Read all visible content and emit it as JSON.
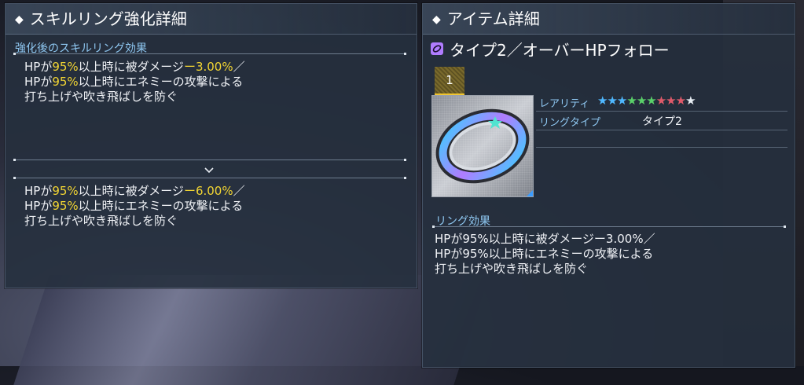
{
  "left_panel": {
    "title": "スキルリング強化詳細",
    "section_heading": "強化後のスキルリング効果",
    "current_effect": {
      "line1_a": "HPが",
      "line1_b": "95%",
      "line1_c": "以上時に被ダメージ",
      "line1_d": "ー3.00%",
      "line1_e": "／",
      "line2_a": "HPが",
      "line2_b": "95%",
      "line2_c": "以上時にエネミーの攻撃による",
      "line3": "打ち上げや吹き飛ばしを防ぐ"
    },
    "enhanced_effect": {
      "line1_a": "HPが",
      "line1_b": "95%",
      "line1_c": "以上時に被ダメージ",
      "line1_d": "ー6.00%",
      "line1_e": "／",
      "line2_a": "HPが",
      "line2_b": "95%",
      "line2_c": "以上時にエネミーの攻撃による",
      "line3": "打ち上げや吹き飛ばしを防ぐ"
    },
    "chevron_icon": "chevron-down-icon"
  },
  "right_panel": {
    "title": "アイテム詳細",
    "item_name": "タイプ2／オーバーHPフォロー",
    "type_icon": "ring-type-icon",
    "level": "1",
    "rarity_label": "レアリティ",
    "rarity": 10,
    "star_colors": [
      "#4fb8ff",
      "#4fb8ff",
      "#4fb8ff",
      "#5ad06a",
      "#5ad06a",
      "#5ad06a",
      "#e05a6a",
      "#e05a6a",
      "#e05a6a",
      "#e8eef4"
    ],
    "ring_type_label": "リングタイプ",
    "ring_type_value": "タイプ2",
    "ring_effect_heading": "リング効果",
    "ring_effect": {
      "line1": "HPが95%以上時に被ダメージー3.00%／",
      "line2": "HPが95%以上時にエネミーの攻撃による",
      "line3": "打ち上げや吹き飛ばしを防ぐ"
    },
    "item_image_icon": "skill-ring-image"
  },
  "colors": {
    "accent_yellow": "#f2d533",
    "heading_blue": "#8fc8f2"
  }
}
